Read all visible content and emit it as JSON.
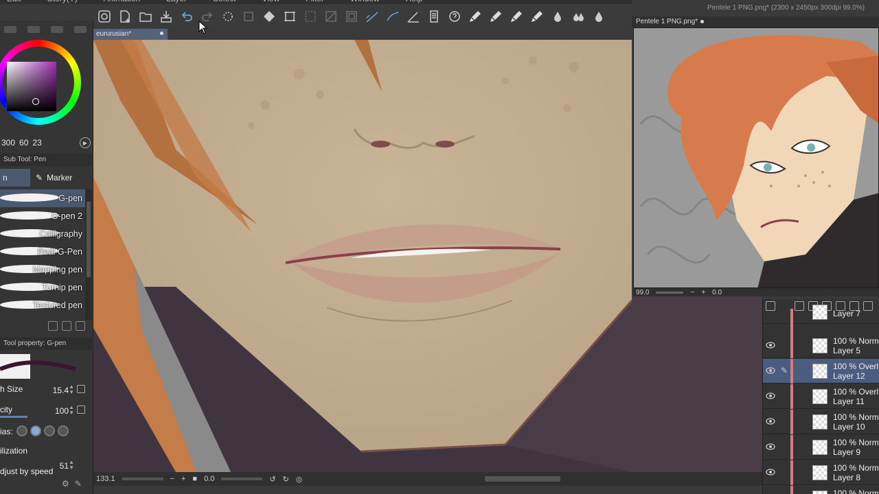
{
  "menubar": {
    "items": [
      "Edit",
      "Story(Y)",
      "Animation",
      "Layer",
      "Select",
      "View",
      "Filter",
      "Window",
      "Help"
    ]
  },
  "toolbar": {
    "icons": [
      "clip-studio-icon",
      "new-file-icon",
      "open-file-icon",
      "save-icon",
      "undo-icon",
      "redo-icon",
      "loading-icon",
      "clear-icon",
      "fill-icon",
      "transform-icon",
      "deselect-icon",
      "invert-icon",
      "border-icon",
      "vector-line-icon",
      "snap-ruler-icon",
      "ruler-icon",
      "sketch-icon",
      "help-icon",
      "brush-1-icon",
      "brush-2-icon",
      "brush-3-icon",
      "brush-4-icon",
      "drop-1-icon",
      "drop-2-icon",
      "drop-3-icon"
    ]
  },
  "color": {
    "hsv": {
      "h": "300",
      "s": "60",
      "v": "23"
    },
    "accent": "#a02fb0"
  },
  "subtool": {
    "header": "Sub Tool: Pen",
    "tab_selected": "n",
    "tab_other": "Marker",
    "brushes": [
      "G-pen",
      "G-pen 2",
      "Calligraphy",
      "Real G-Pen",
      "Mapping pen",
      "Turnip pen",
      "Textured pen"
    ]
  },
  "toolprop": {
    "header": "Tool property: G-pen",
    "brush_size_label": "h Size",
    "brush_size_value": "15.4",
    "opacity_label": "city",
    "opacity_value": "100",
    "antialias_label": "ias:",
    "stabilization_label": "ilization",
    "stabilization_value": "51",
    "adjust_label": "djust by speed"
  },
  "canvas": {
    "tab_title": "eururusian*",
    "zoom": "133.1",
    "rotation": "0.0"
  },
  "navigator": {
    "title": "Pentele 1 PNG.png*",
    "path": "Pentele 1 PNG.png* (2300 x 2450px 300dpi 99.0%)",
    "zoom": "99.0",
    "rotation": "0.0"
  },
  "layers": [
    {
      "blend": "",
      "name": "Layer 7",
      "selected": false,
      "pen": false
    },
    {
      "blend": "100 % Norm",
      "name": "Layer 5",
      "selected": false,
      "pen": false
    },
    {
      "blend": "100 % Overl",
      "name": "Layer 12",
      "selected": true,
      "pen": true
    },
    {
      "blend": "100 % Overl",
      "name": "Layer 11",
      "selected": false,
      "pen": false
    },
    {
      "blend": "100 % Norm",
      "name": "Layer 10",
      "selected": false,
      "pen": false
    },
    {
      "blend": "100 % Norm",
      "name": "Layer 9",
      "selected": false,
      "pen": false
    },
    {
      "blend": "100 % Norm",
      "name": "Layer 8",
      "selected": false,
      "pen": false
    },
    {
      "blend": "100 % Norm",
      "name": "",
      "selected": false,
      "pen": false
    }
  ]
}
